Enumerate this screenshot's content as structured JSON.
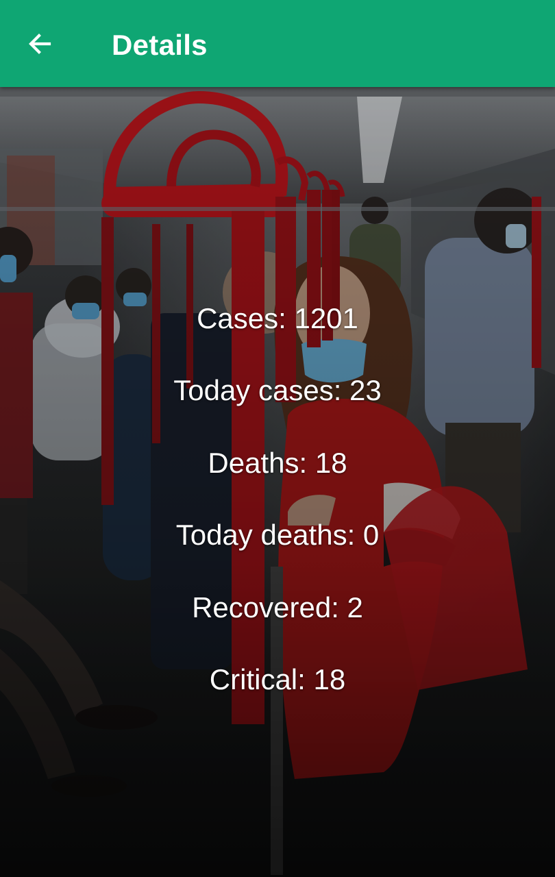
{
  "app_bar": {
    "title": "Details",
    "back_icon": "arrow-left-icon",
    "color": "#0fa673"
  },
  "stats": [
    {
      "key": "cases",
      "text": "Cases: 1201"
    },
    {
      "key": "today_cases",
      "text": "Today cases: 23"
    },
    {
      "key": "deaths",
      "text": "Deaths: 18"
    },
    {
      "key": "today_deaths",
      "text": "Today deaths: 0"
    },
    {
      "key": "recovered",
      "text": "Recovered: 2"
    },
    {
      "key": "critical",
      "text": "Critical: 18"
    }
  ],
  "background": {
    "icon": "subway-passengers-photo"
  }
}
